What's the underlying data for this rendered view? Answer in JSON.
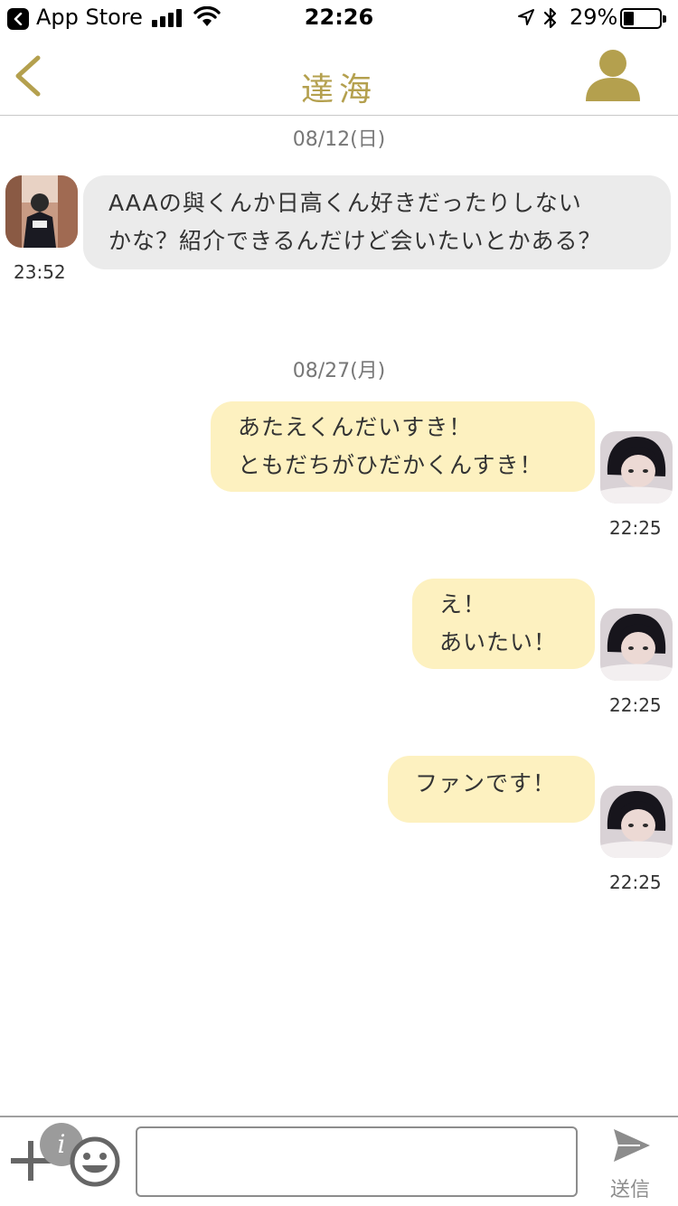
{
  "status_bar": {
    "back_app": "App Store",
    "time": "22:26",
    "battery": "29%",
    "battery_level": 0.29
  },
  "nav": {
    "title": "達海"
  },
  "chat": {
    "sections": [
      {
        "date": "08/12(日)"
      },
      {
        "date": "08/27(月)"
      }
    ],
    "messages": [
      {
        "side": "received",
        "text": "AAAの與くんか日高くん好きだったりしない\nかな？紹介できるんだけど会いたいとかある？",
        "time": "23:52"
      },
      {
        "side": "sent",
        "text": "あたえくんだいすき！\nともだちがひだかくんすき！",
        "time": "22:25"
      },
      {
        "side": "sent",
        "text": "え！\nあいたい！",
        "time": "22:25"
      },
      {
        "side": "sent",
        "text": "ファンです！",
        "time": "22:25"
      }
    ]
  },
  "composer": {
    "info_glyph": "i",
    "placeholder": "",
    "send_label": "送信"
  },
  "colors": {
    "accent_gold": "#b4a04e",
    "sent_bubble": "#fdf1c0",
    "received_bubble": "#ebebeb"
  },
  "icons": {
    "status_back": "chevron-left-icon",
    "signal": "signal-bars-icon",
    "wifi": "wifi-icon",
    "location": "location-arrow-icon",
    "bluetooth": "bluetooth-icon",
    "battery": "battery-icon",
    "nav_back": "chevron-left-icon",
    "profile": "person-icon",
    "plus": "plus-icon",
    "info": "info-icon",
    "emoji": "smiley-icon",
    "send": "paper-plane-icon"
  }
}
